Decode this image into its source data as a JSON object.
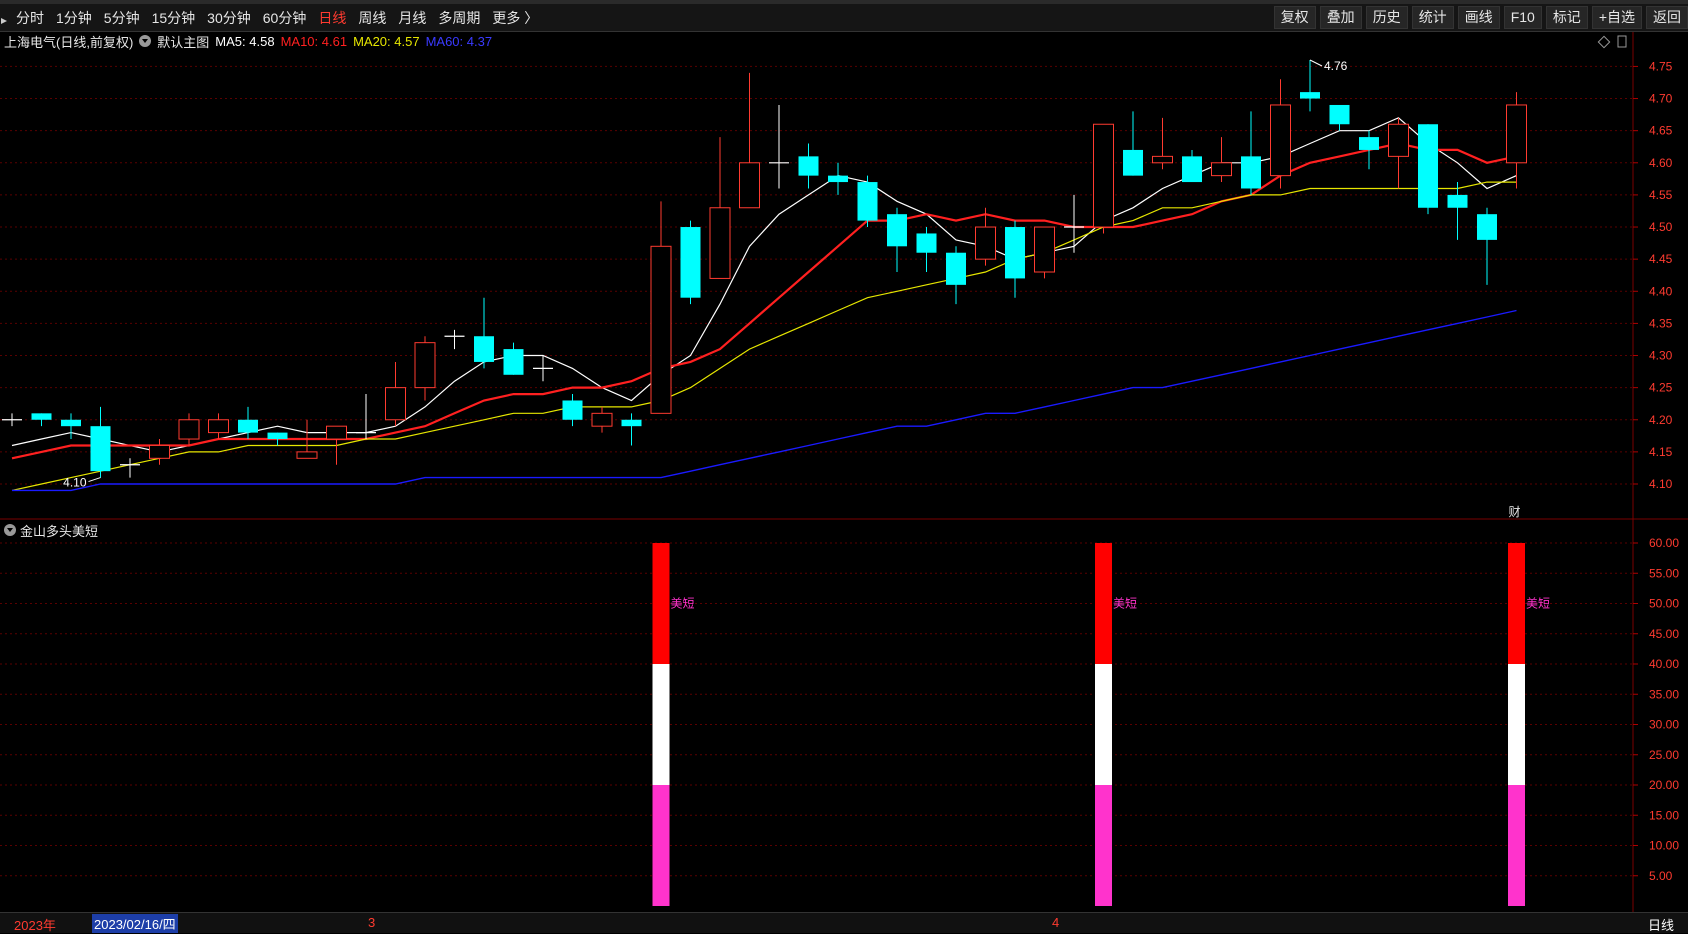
{
  "toolbar": {
    "periods": [
      "分时",
      "1分钟",
      "5分钟",
      "15分钟",
      "30分钟",
      "60分钟",
      "日线",
      "周线",
      "月线",
      "多周期",
      "更多 〉"
    ],
    "active_period": "日线",
    "right_buttons": [
      "复权",
      "叠加",
      "历史",
      "统计",
      "画线",
      "F10",
      "+自选",
      "返回"
    ],
    "mark_label": "标记"
  },
  "main_legend": {
    "title": "上海电气(日线,前复权)",
    "main_indicator": "默认主图",
    "ma5": "MA5: 4.58",
    "ma10": "MA10: 4.61",
    "ma20": "MA20: 4.57",
    "ma60": "MA60: 4.37"
  },
  "colors": {
    "up": "#ff3b30",
    "down": "#00ffff",
    "ma5": "#ffffff",
    "ma10": "#ff2020",
    "ma20": "#e6e600",
    "ma60": "#1a1aff",
    "signal_red": "#ff0000",
    "signal_white": "#ffffff",
    "signal_pink": "#ff33cc",
    "signal_text": "#ff33cc",
    "grid": "#5a0000"
  },
  "main_y_ticks": [
    "4.75",
    "4.70",
    "4.65",
    "4.60",
    "4.55",
    "4.50",
    "4.45",
    "4.40",
    "4.35",
    "4.30",
    "4.25",
    "4.20",
    "4.15",
    "4.10"
  ],
  "annotations": {
    "high": "4.76",
    "low": "4.10",
    "fin_marker": "财"
  },
  "indicator": {
    "name": "金山多头美短",
    "signal_label": "美短",
    "y_ticks": [
      "60.00",
      "55.00",
      "50.00",
      "45.00",
      "40.00",
      "35.00",
      "30.00",
      "25.00",
      "20.00",
      "15.00",
      "10.00",
      "5.00"
    ]
  },
  "bottom": {
    "year": "2023年",
    "date": "2023/02/16/四",
    "month3": "3",
    "month4": "4",
    "period": "日线"
  },
  "chart_data": [
    {
      "type": "candlestick",
      "ylim": [
        4.06,
        4.78
      ],
      "candles": [
        {
          "o": 4.2,
          "h": 4.21,
          "l": 4.19,
          "c": 4.2
        },
        {
          "o": 4.21,
          "h": 4.21,
          "l": 4.19,
          "c": 4.2
        },
        {
          "o": 4.2,
          "h": 4.21,
          "l": 4.17,
          "c": 4.19
        },
        {
          "o": 4.19,
          "h": 4.22,
          "l": 4.11,
          "c": 4.12
        },
        {
          "o": 4.13,
          "h": 4.14,
          "l": 4.11,
          "c": 4.13
        },
        {
          "o": 4.14,
          "h": 4.17,
          "l": 4.13,
          "c": 4.16
        },
        {
          "o": 4.17,
          "h": 4.21,
          "l": 4.16,
          "c": 4.2
        },
        {
          "o": 4.18,
          "h": 4.21,
          "l": 4.17,
          "c": 4.2
        },
        {
          "o": 4.2,
          "h": 4.22,
          "l": 4.17,
          "c": 4.18
        },
        {
          "o": 4.18,
          "h": 4.18,
          "l": 4.16,
          "c": 4.17
        },
        {
          "o": 4.14,
          "h": 4.2,
          "l": 4.14,
          "c": 4.15
        },
        {
          "o": 4.17,
          "h": 4.19,
          "l": 4.13,
          "c": 4.19
        },
        {
          "o": 4.18,
          "h": 4.24,
          "l": 4.17,
          "c": 4.18
        },
        {
          "o": 4.2,
          "h": 4.29,
          "l": 4.19,
          "c": 4.25
        },
        {
          "o": 4.25,
          "h": 4.33,
          "l": 4.23,
          "c": 4.32
        },
        {
          "o": 4.33,
          "h": 4.34,
          "l": 4.31,
          "c": 4.33
        },
        {
          "o": 4.33,
          "h": 4.39,
          "l": 4.28,
          "c": 4.29
        },
        {
          "o": 4.31,
          "h": 4.32,
          "l": 4.27,
          "c": 4.27
        },
        {
          "o": 4.28,
          "h": 4.3,
          "l": 4.26,
          "c": 4.28
        },
        {
          "o": 4.23,
          "h": 4.24,
          "l": 4.19,
          "c": 4.2
        },
        {
          "o": 4.19,
          "h": 4.22,
          "l": 4.18,
          "c": 4.21
        },
        {
          "o": 4.2,
          "h": 4.21,
          "l": 4.16,
          "c": 4.19
        },
        {
          "o": 4.21,
          "h": 4.54,
          "l": 4.21,
          "c": 4.47
        },
        {
          "o": 4.5,
          "h": 4.51,
          "l": 4.38,
          "c": 4.39
        },
        {
          "o": 4.42,
          "h": 4.64,
          "l": 4.42,
          "c": 4.53
        },
        {
          "o": 4.53,
          "h": 4.74,
          "l": 4.53,
          "c": 4.6
        },
        {
          "o": 4.6,
          "h": 4.69,
          "l": 4.56,
          "c": 4.6
        },
        {
          "o": 4.61,
          "h": 4.63,
          "l": 4.56,
          "c": 4.58
        },
        {
          "o": 4.58,
          "h": 4.6,
          "l": 4.55,
          "c": 4.57
        },
        {
          "o": 4.57,
          "h": 4.58,
          "l": 4.5,
          "c": 4.51
        },
        {
          "o": 4.52,
          "h": 4.53,
          "l": 4.43,
          "c": 4.47
        },
        {
          "o": 4.49,
          "h": 4.5,
          "l": 4.43,
          "c": 4.46
        },
        {
          "o": 4.46,
          "h": 4.47,
          "l": 4.38,
          "c": 4.41
        },
        {
          "o": 4.45,
          "h": 4.53,
          "l": 4.44,
          "c": 4.5
        },
        {
          "o": 4.5,
          "h": 4.51,
          "l": 4.39,
          "c": 4.42
        },
        {
          "o": 4.43,
          "h": 4.5,
          "l": 4.42,
          "c": 4.5
        },
        {
          "o": 4.5,
          "h": 4.55,
          "l": 4.46,
          "c": 4.5
        },
        {
          "o": 4.5,
          "h": 4.66,
          "l": 4.49,
          "c": 4.66
        },
        {
          "o": 4.62,
          "h": 4.68,
          "l": 4.58,
          "c": 4.58
        },
        {
          "o": 4.6,
          "h": 4.67,
          "l": 4.59,
          "c": 4.61
        },
        {
          "o": 4.61,
          "h": 4.62,
          "l": 4.57,
          "c": 4.57
        },
        {
          "o": 4.58,
          "h": 4.64,
          "l": 4.57,
          "c": 4.6
        },
        {
          "o": 4.61,
          "h": 4.68,
          "l": 4.55,
          "c": 4.56
        },
        {
          "o": 4.58,
          "h": 4.73,
          "l": 4.56,
          "c": 4.69
        },
        {
          "o": 4.71,
          "h": 4.76,
          "l": 4.68,
          "c": 4.7
        },
        {
          "o": 4.69,
          "h": 4.69,
          "l": 4.65,
          "c": 4.66
        },
        {
          "o": 4.64,
          "h": 4.65,
          "l": 4.59,
          "c": 4.62
        },
        {
          "o": 4.61,
          "h": 4.67,
          "l": 4.56,
          "c": 4.66
        },
        {
          "o": 4.66,
          "h": 4.66,
          "l": 4.52,
          "c": 4.53
        },
        {
          "o": 4.55,
          "h": 4.57,
          "l": 4.48,
          "c": 4.53
        },
        {
          "o": 4.52,
          "h": 4.53,
          "l": 4.41,
          "c": 4.48
        },
        {
          "o": 4.6,
          "h": 4.71,
          "l": 4.56,
          "c": 4.69
        }
      ],
      "series": [
        {
          "name": "MA5",
          "values": [
            4.16,
            4.17,
            4.18,
            4.17,
            4.16,
            4.15,
            4.16,
            4.17,
            4.18,
            4.19,
            4.18,
            4.18,
            4.18,
            4.19,
            4.22,
            4.26,
            4.29,
            4.3,
            4.3,
            4.28,
            4.25,
            4.23,
            4.27,
            4.3,
            4.38,
            4.47,
            4.52,
            4.55,
            4.58,
            4.57,
            4.54,
            4.52,
            4.48,
            4.47,
            4.45,
            4.46,
            4.47,
            4.51,
            4.53,
            4.56,
            4.58,
            4.6,
            4.6,
            4.61,
            4.63,
            4.65,
            4.65,
            4.67,
            4.63,
            4.6,
            4.56,
            4.58
          ]
        },
        {
          "name": "MA10",
          "values": [
            4.14,
            4.15,
            4.16,
            4.16,
            4.16,
            4.16,
            4.16,
            4.17,
            4.17,
            4.17,
            4.17,
            4.17,
            4.17,
            4.18,
            4.19,
            4.21,
            4.23,
            4.24,
            4.24,
            4.25,
            4.25,
            4.26,
            4.28,
            4.29,
            4.31,
            4.35,
            4.39,
            4.43,
            4.47,
            4.51,
            4.51,
            4.52,
            4.51,
            4.52,
            4.51,
            4.51,
            4.5,
            4.5,
            4.5,
            4.51,
            4.52,
            4.54,
            4.55,
            4.58,
            4.6,
            4.61,
            4.62,
            4.63,
            4.62,
            4.62,
            4.6,
            4.61
          ]
        },
        {
          "name": "MA20",
          "values": [
            4.09,
            4.1,
            4.11,
            4.12,
            4.13,
            4.14,
            4.15,
            4.15,
            4.16,
            4.16,
            4.16,
            4.16,
            4.17,
            4.17,
            4.18,
            4.19,
            4.2,
            4.21,
            4.21,
            4.22,
            4.22,
            4.22,
            4.23,
            4.25,
            4.28,
            4.31,
            4.33,
            4.35,
            4.37,
            4.39,
            4.4,
            4.41,
            4.42,
            4.43,
            4.45,
            4.46,
            4.48,
            4.5,
            4.51,
            4.53,
            4.53,
            4.54,
            4.55,
            4.55,
            4.56,
            4.56,
            4.56,
            4.56,
            4.56,
            4.56,
            4.57,
            4.57
          ]
        },
        {
          "name": "MA60",
          "values": [
            4.09,
            4.09,
            4.09,
            4.1,
            4.1,
            4.1,
            4.1,
            4.1,
            4.1,
            4.1,
            4.1,
            4.1,
            4.1,
            4.1,
            4.11,
            4.11,
            4.11,
            4.11,
            4.11,
            4.11,
            4.11,
            4.11,
            4.11,
            4.12,
            4.13,
            4.14,
            4.15,
            4.16,
            4.17,
            4.18,
            4.19,
            4.19,
            4.2,
            4.21,
            4.21,
            4.22,
            4.23,
            4.24,
            4.25,
            4.25,
            4.26,
            4.27,
            4.28,
            4.29,
            4.3,
            4.31,
            4.32,
            4.33,
            4.34,
            4.35,
            4.36,
            4.37
          ]
        }
      ]
    },
    {
      "type": "bar",
      "name": "金山多头美短",
      "ylim": [
        0,
        62
      ],
      "signals": [
        {
          "index": 22,
          "segments": [
            {
              "from": 40,
              "to": 60,
              "color": "red"
            },
            {
              "from": 20,
              "to": 40,
              "color": "white"
            },
            {
              "from": 0,
              "to": 20,
              "color": "pink"
            }
          ],
          "label": "美短"
        },
        {
          "index": 37,
          "segments": [
            {
              "from": 40,
              "to": 60,
              "color": "red"
            },
            {
              "from": 20,
              "to": 40,
              "color": "white"
            },
            {
              "from": 0,
              "to": 20,
              "color": "pink"
            }
          ],
          "label": "美短"
        },
        {
          "index": 51,
          "segments": [
            {
              "from": 40,
              "to": 60,
              "color": "red"
            },
            {
              "from": 20,
              "to": 40,
              "color": "white"
            },
            {
              "from": 0,
              "to": 20,
              "color": "pink"
            }
          ],
          "label": "美短"
        }
      ]
    }
  ]
}
